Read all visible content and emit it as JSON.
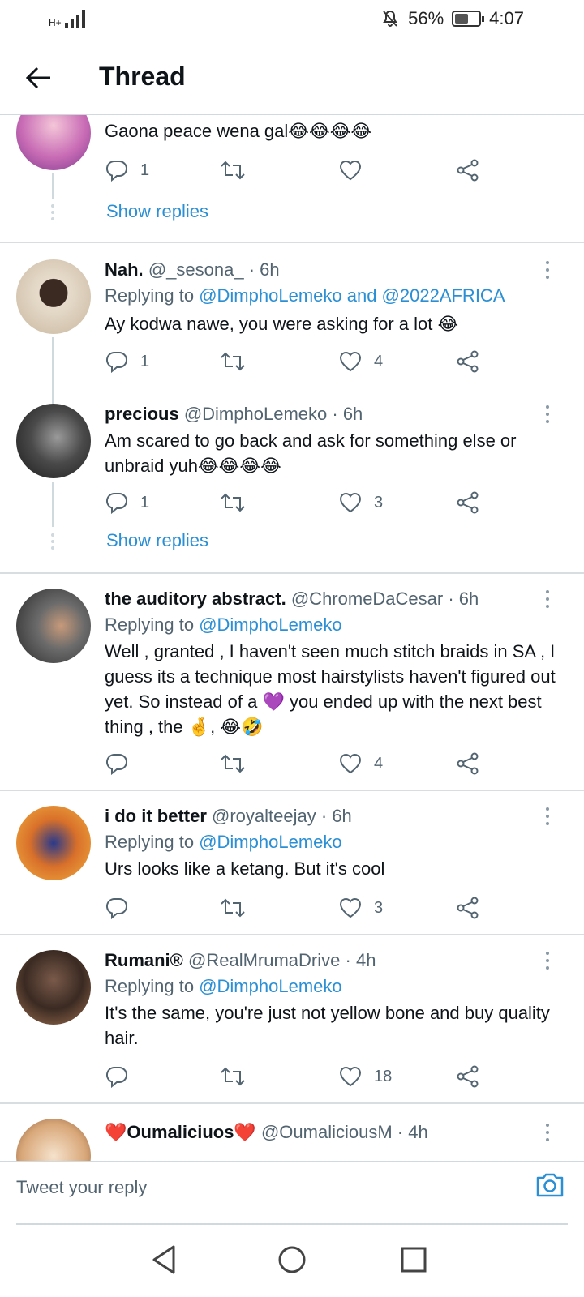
{
  "status_bar": {
    "network": "H+",
    "battery_percent": "56%",
    "battery_level": 0.56,
    "time": "4:07"
  },
  "header": {
    "title": "Thread"
  },
  "tweets": [
    {
      "text": "Gaona peace wena gal😂😂😂😂",
      "replies": "1",
      "retweets": "",
      "likes": "",
      "show_replies": "Show replies",
      "avatar_color": "#c86bb5"
    },
    {
      "name": "Nah.",
      "handle": "@_sesona_",
      "time": "· 6h",
      "replying_prefix": "Replying to",
      "replying_to": "@DimphoLemeko and @2022AFRICA",
      "text": "Ay kodwa nawe, you were asking for a lot 😂",
      "replies": "1",
      "retweets": "",
      "likes": "4",
      "avatar_color": "#cdbfa8"
    },
    {
      "name": "precious",
      "handle": "@DimphoLemeko",
      "time": "· 6h",
      "text": "Am scared to go back and ask for something else or unbraid yuh😂😂😂😂",
      "replies": "1",
      "retweets": "",
      "likes": "3",
      "show_replies": "Show replies",
      "avatar_color": "#3a3a3a"
    },
    {
      "name": "the auditory abstract.",
      "handle": "@ChromeDaCesar",
      "time": "· 6h",
      "replying_prefix": "Replying to",
      "replying_to": "@DimphoLemeko",
      "text": "Well , granted , I haven't seen much stitch braids in SA , I guess its a technique most hairstylists haven't figured out yet. So instead of a 💜 you ended up with the next best thing , the 🤞, 😂🤣",
      "replies": "",
      "retweets": "",
      "likes": "4",
      "avatar_color": "#6b6b6b"
    },
    {
      "name": "i do it better",
      "handle": "@royalteejay",
      "time": "· 6h",
      "replying_prefix": "Replying to",
      "replying_to": "@DimphoLemeko",
      "text": "Urs looks like a ketang. But it's cool",
      "replies": "",
      "retweets": "",
      "likes": "3",
      "avatar_color": "#f0a030"
    },
    {
      "name": "Rumani®",
      "handle": "@RealMrumaDrive",
      "time": "· 4h",
      "replying_prefix": "Replying to",
      "replying_to": "@DimphoLemeko",
      "text": "It's the same, you're just not yellow bone and buy quality hair.",
      "replies": "",
      "retweets": "",
      "likes": "18",
      "avatar_color": "#5a3a2a"
    },
    {
      "name": "❤️Oumaliciuos❤️",
      "handle": "@OumaliciousM",
      "time": "· 4h",
      "avatar_color": "#d9a87a"
    }
  ],
  "reply_bar": {
    "placeholder": "Tweet your reply"
  },
  "colors": {
    "accent": "#2a8fd4",
    "divider": "#d8dde0",
    "muted": "#536471"
  }
}
